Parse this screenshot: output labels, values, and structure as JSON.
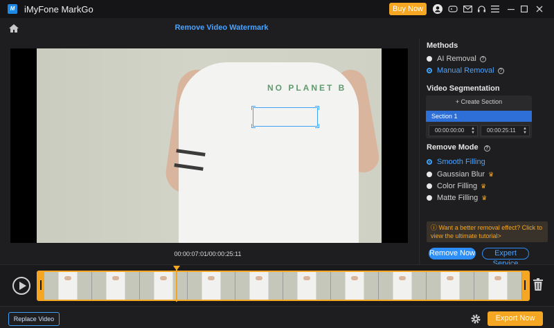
{
  "app": {
    "title": "iMyFone MarkGo",
    "buy_label": "Buy Now",
    "logo_text": "M"
  },
  "header": {
    "page_title": "Remove Video Watermark"
  },
  "video": {
    "shirt_text": "NO PLANET  B",
    "timecode": "00:00:07:01/00:00:25:11"
  },
  "methods": {
    "title": "Methods",
    "options": [
      {
        "label": "AI Removal",
        "selected": false
      },
      {
        "label": "Manual Removal",
        "selected": true
      }
    ]
  },
  "segmentation": {
    "title": "Video Segmentation",
    "create_label": "+ Create Section",
    "section_label": "Section 1",
    "start_time": "00:00:00:00",
    "end_time": "00:00:25:11"
  },
  "remove_mode": {
    "title": "Remove Mode",
    "options": [
      {
        "label": "Smooth Filling",
        "selected": true,
        "premium": false
      },
      {
        "label": "Gaussian Blur",
        "selected": false,
        "premium": true
      },
      {
        "label": "Color Filling",
        "selected": false,
        "premium": true
      },
      {
        "label": "Matte Filling",
        "selected": false,
        "premium": true
      }
    ]
  },
  "tip": {
    "text": "Want a better removal effect? Click to view the ultimate tutorial>"
  },
  "actions": {
    "remove_now": "Remove Now",
    "expert_service": "Expert Service",
    "replace_video": "Replace Video",
    "export_now": "Export Now"
  },
  "colors": {
    "accent": "#3fa2f7",
    "brand_orange": "#f5a623"
  }
}
